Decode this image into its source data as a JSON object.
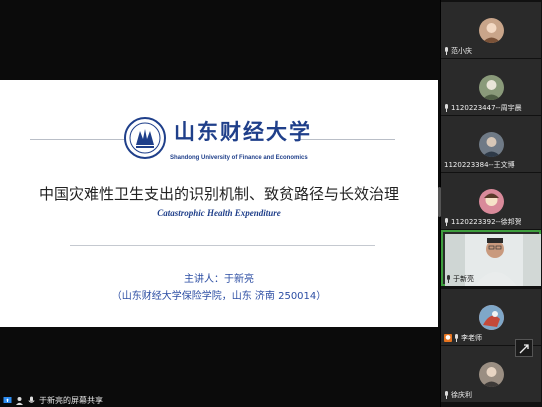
{
  "slide": {
    "logo_cn": "山东财经大学",
    "logo_en": "Shandong University of Finance and Economics",
    "title": "中国灾难性卫生支出的识别机制、致贫路径与长效治理",
    "subtitle": "Catastrophic Health Expenditure",
    "presenter": "主讲人：于新亮",
    "affiliation": "（山东财经大学保险学院，山东  济南  250014）"
  },
  "share_bar": {
    "label": "于新亮的屏幕共享"
  },
  "participants": [
    {
      "name": "范小庆",
      "kind": "avatar",
      "color": "#c9a58a"
    },
    {
      "name": "1120223447--周宇晨",
      "kind": "avatar",
      "color": "#8a9a7a"
    },
    {
      "name": "1120223384--王文博",
      "kind": "avatar",
      "color": "#6f7a86"
    },
    {
      "name": "1120223392--徐邦贺",
      "kind": "avatar",
      "color": "#d98a9a"
    },
    {
      "name": "于新亮",
      "kind": "video",
      "active": true
    },
    {
      "name": "李老师",
      "kind": "avatar",
      "color": "#c96a5a",
      "host": true
    },
    {
      "name": "徐庆利",
      "kind": "avatar",
      "color": "#9a8e82"
    }
  ],
  "icons": {
    "share_icon": "screen-share-icon",
    "mic": "mic-icon",
    "host": "host-icon",
    "expand": "expand-icon"
  },
  "colors": {
    "brand_blue": "#1f3f8a",
    "active_speaker": "#3e9e3e"
  }
}
